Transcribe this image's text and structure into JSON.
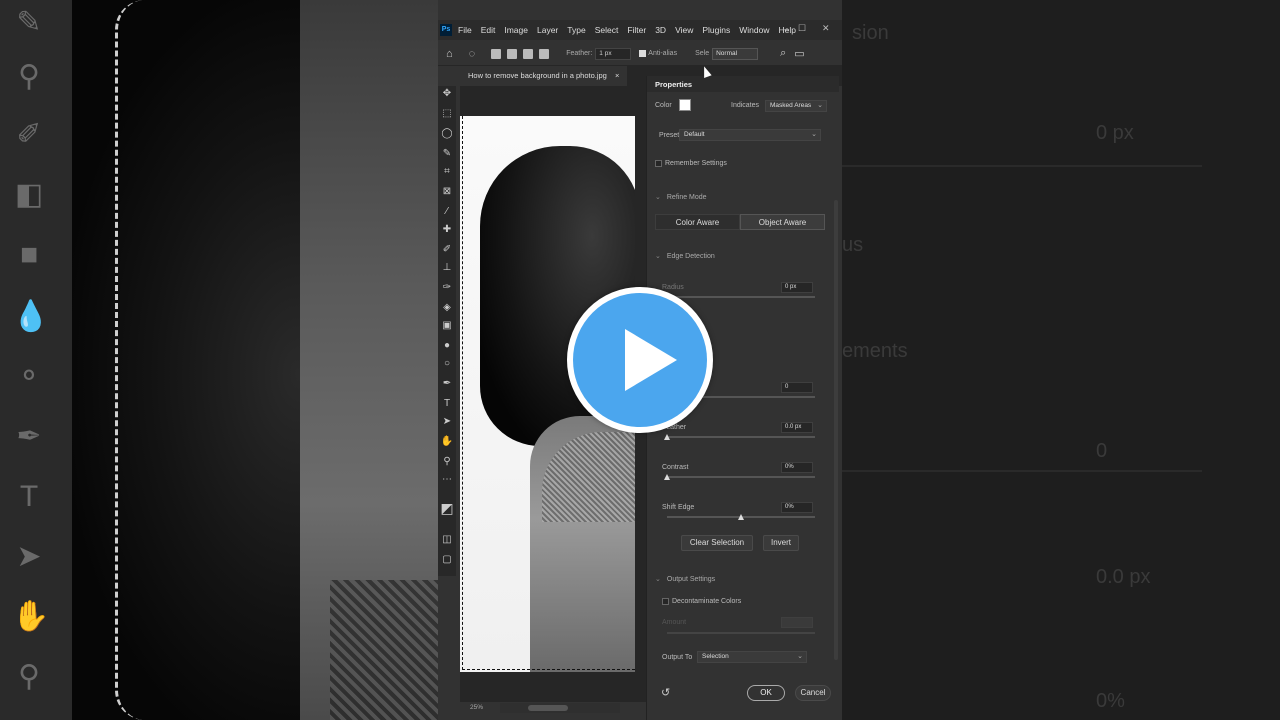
{
  "menubar": {
    "logo": "Ps",
    "items": [
      "File",
      "Edit",
      "Image",
      "Layer",
      "Type",
      "Select",
      "Filter",
      "3D",
      "View",
      "Plugins",
      "Window",
      "Help"
    ],
    "minimize": "—",
    "maximize": "☐",
    "close": "✕"
  },
  "options": {
    "feather_label": "Feather:",
    "feather_value": "1 px",
    "antialias_label": "Anti-alias",
    "select_label": "Sele",
    "mode_value": "Normal"
  },
  "document": {
    "tab_title": "How to remove background in a photo.jpg",
    "tab_close": "×",
    "zoom": "25%"
  },
  "properties": {
    "title": "Properties",
    "color_label": "Color",
    "indicates_label": "Indicates",
    "indicates_value": "Masked Areas",
    "preset_label": "Preset",
    "preset_value": "Default",
    "remember_label": "Remember Settings",
    "refine_mode_label": "Refine Mode",
    "color_aware": "Color Aware",
    "object_aware": "Object Aware",
    "edge_detection_label": "Edge Detection",
    "radius_label": "Radius",
    "radius_value": "0 px",
    "smooth_value": "0",
    "feather_label": "Feather",
    "feather_value": "0.0 px",
    "contrast_label": "Contrast",
    "contrast_value": "0%",
    "shift_edge_label": "Shift Edge",
    "shift_edge_value": "0%",
    "clear_selection": "Clear Selection",
    "invert": "Invert",
    "output_settings_label": "Output Settings",
    "decontaminate_label": "Decontaminate Colors",
    "amount_label": "Amount",
    "output_to_label": "Output To",
    "output_to_value": "Selection",
    "ok": "OK",
    "cancel": "Cancel",
    "slider_levels": {
      "radius": 0,
      "feather": 0,
      "contrast": 0,
      "shift_edge": 0.5
    }
  },
  "background_right": {
    "ghost_radius_value": "0 px",
    "ghost_smooth_value": "0",
    "ghost_feather_value": "0.0 px",
    "ghost_percent_value": "0%",
    "ghost_partial_1": "sion",
    "ghost_partial_2": "us",
    "ghost_partial_3": "ements"
  },
  "icons": {
    "home": "home-icon",
    "lasso": "lasso-icon",
    "search": "search-icon",
    "workspace": "workspace-icon",
    "play": "play-icon",
    "reset": "reset-icon"
  }
}
